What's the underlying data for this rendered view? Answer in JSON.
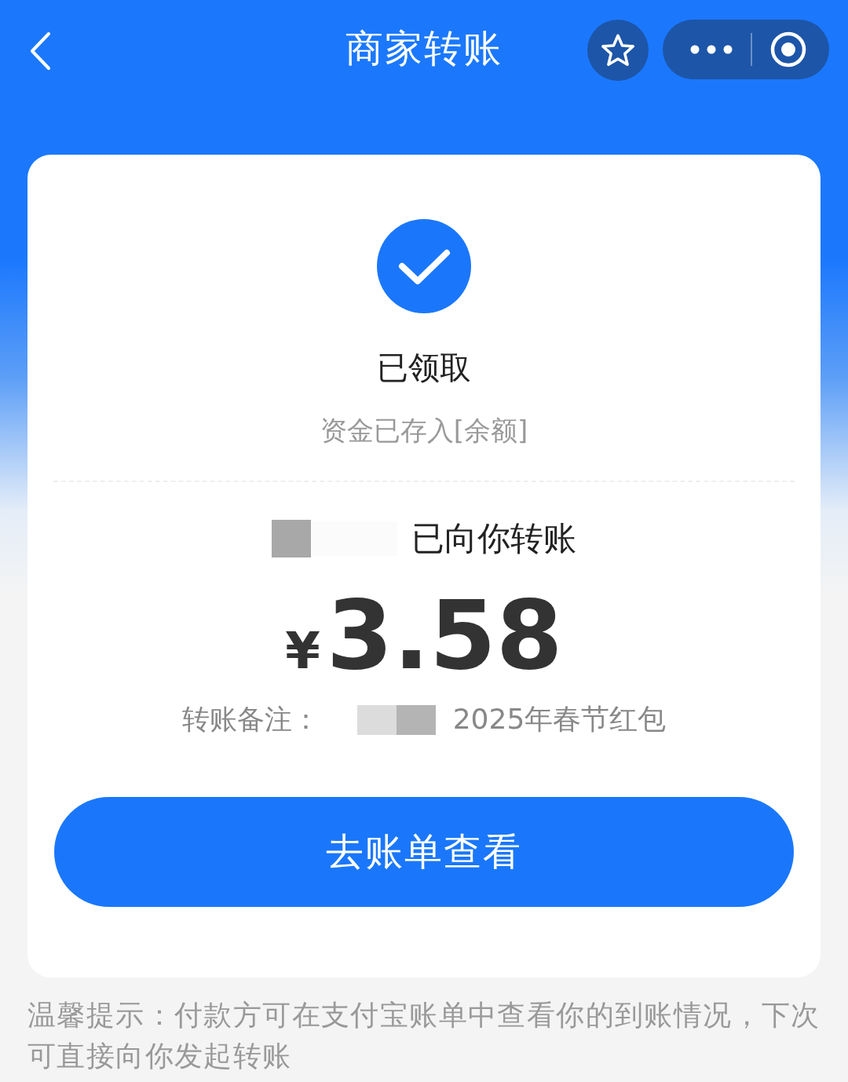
{
  "nav": {
    "title": "商家转账"
  },
  "status": {
    "label": "已领取",
    "detail": "资金已存入[余额]"
  },
  "transfer": {
    "message": "已向你转账",
    "currency": "¥",
    "amount": "3.58",
    "note_label": "转账备注：",
    "note": "2025年春节红包"
  },
  "action_button": {
    "label": "去账单查看"
  },
  "tip": "温馨提示：付款方可在支付宝账单中查看你的到账情况，下次可直接向你发起转账"
}
